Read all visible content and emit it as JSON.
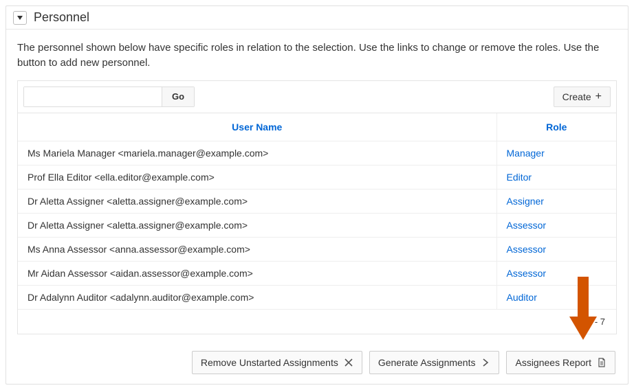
{
  "panel": {
    "title": "Personnel",
    "description": "The personnel shown below have specific roles in relation to the selection. Use the links to change or remove the roles. Use the button to add new personnel."
  },
  "toolbar": {
    "search_placeholder": "",
    "go_label": "Go",
    "create_label": "Create"
  },
  "table": {
    "header_user": "User Name",
    "header_role": "Role",
    "rows": [
      {
        "user": "Ms Mariela Manager <mariela.manager@example.com>",
        "role": "Manager"
      },
      {
        "user": "Prof Ella Editor <ella.editor@example.com>",
        "role": "Editor"
      },
      {
        "user": "Dr Aletta Assigner <aletta.assigner@example.com>",
        "role": "Assigner"
      },
      {
        "user": "Dr Aletta Assigner <aletta.assigner@example.com>",
        "role": "Assessor"
      },
      {
        "user": "Ms Anna Assessor <anna.assessor@example.com>",
        "role": "Assessor"
      },
      {
        "user": "Mr Aidan Assessor <aidan.assessor@example.com>",
        "role": "Assessor"
      },
      {
        "user": "Dr Adalynn Auditor <adalynn.auditor@example.com>",
        "role": "Auditor"
      }
    ],
    "pager": "1 - 7"
  },
  "actions": {
    "remove_unstarted": "Remove Unstarted Assignments",
    "generate": "Generate Assignments",
    "assignees_report": "Assignees Report"
  },
  "callout": {
    "color": "#d35400"
  }
}
